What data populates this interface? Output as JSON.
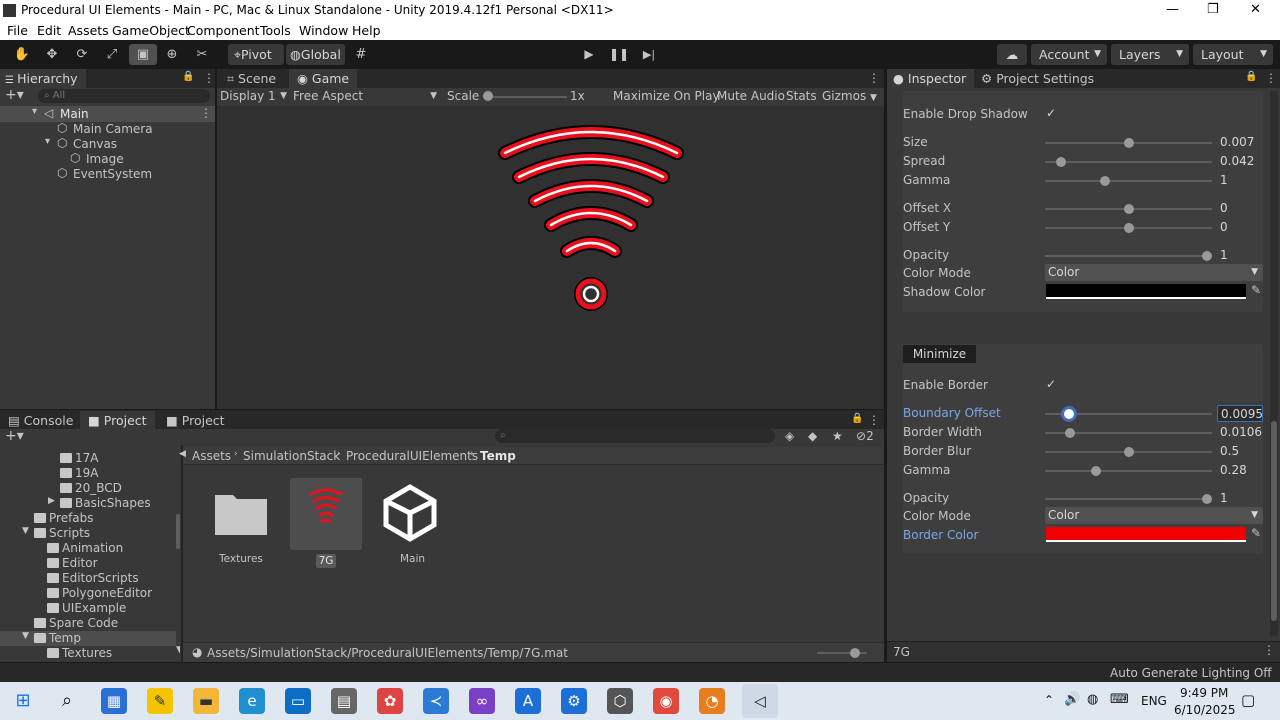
{
  "window": {
    "title": "Procedural UI Elements - Main - PC, Mac & Linux Standalone - Unity 2019.4.12f1 Personal <DX11>"
  },
  "menu": [
    "File",
    "Edit",
    "Assets",
    "GameObject",
    "Component",
    "Tools",
    "Window",
    "Help"
  ],
  "toolbar": {
    "pivot": "Pivot",
    "global": "Global",
    "account": "Account",
    "layers": "Layers",
    "layout": "Layout"
  },
  "hierarchy": {
    "tab": "Hierarchy",
    "search_placeholder": "All",
    "items": [
      {
        "label": "Main"
      },
      {
        "label": "Main Camera"
      },
      {
        "label": "Canvas"
      },
      {
        "label": "Image"
      },
      {
        "label": "EventSystem"
      }
    ]
  },
  "game": {
    "tabs": [
      "Scene",
      "Game"
    ],
    "display": "Display 1",
    "aspect": "Free Aspect",
    "scale_label": "Scale",
    "scale_value": "1x",
    "maximize": "Maximize On Play",
    "mute": "Mute Audio",
    "stats": "Stats",
    "gizmos": "Gizmos",
    "icon_color": "#e8101c"
  },
  "inspector": {
    "tabs": [
      "Inspector",
      "Project Settings"
    ],
    "shadow": {
      "enable_label": "Enable Drop Shadow",
      "fields": [
        {
          "label": "Size",
          "value": "0.007",
          "fraction": 0.5
        },
        {
          "label": "Spread",
          "value": "0.042",
          "fraction": 0.07
        },
        {
          "label": "Gamma",
          "value": "1",
          "fraction": 0.35
        },
        {
          "label": "Offset X",
          "value": "0",
          "fraction": 0.5
        },
        {
          "label": "Offset Y",
          "value": "0",
          "fraction": 0.5
        },
        {
          "label": "Opacity",
          "value": "1",
          "fraction": 1.0
        }
      ],
      "color_mode_label": "Color Mode",
      "color_mode_value": "Color",
      "shadow_color_label": "Shadow Color",
      "shadow_color": "#000000"
    },
    "minimize": {
      "header": "Minimize",
      "enable_label": "Enable Border",
      "fields": [
        {
          "label": "Boundary Offset",
          "value": "0.0095",
          "fraction": 0.12,
          "highlight": true
        },
        {
          "label": "Border Width",
          "value": "0.0106",
          "fraction": 0.13
        },
        {
          "label": "Border Blur",
          "value": "0.5",
          "fraction": 0.5
        },
        {
          "label": "Gamma",
          "value": "0.28",
          "fraction": 0.29
        },
        {
          "label": "Opacity",
          "value": "1",
          "fraction": 1.0
        }
      ],
      "color_mode_label": "Color Mode",
      "color_mode_value": "Color",
      "border_color_label": "Border Color",
      "border_color": "#f00000"
    },
    "footer_name": "7G"
  },
  "project": {
    "tabs": [
      "Console",
      "Project",
      "Project"
    ],
    "count": "2",
    "tree": [
      {
        "label": "17A",
        "depth": 3
      },
      {
        "label": "19A",
        "depth": 3
      },
      {
        "label": "20_BCD",
        "depth": 3
      },
      {
        "label": "BasicShapes",
        "depth": 3,
        "fold": true
      },
      {
        "label": "Prefabs",
        "depth": 1
      },
      {
        "label": "Scripts",
        "depth": 1,
        "open": true
      },
      {
        "label": "Animation",
        "depth": 2
      },
      {
        "label": "Editor",
        "depth": 2
      },
      {
        "label": "EditorScripts",
        "depth": 2
      },
      {
        "label": "PolygoneEditor",
        "depth": 2
      },
      {
        "label": "UIExample",
        "depth": 2
      },
      {
        "label": "Spare Code",
        "depth": 1
      },
      {
        "label": "Temp",
        "depth": 1,
        "open": true,
        "selected": true
      },
      {
        "label": "Textures",
        "depth": 2
      }
    ],
    "breadcrumb": [
      "Assets",
      "SimulationStack",
      "ProceduralUIElements",
      "Temp"
    ],
    "assets": [
      {
        "label": "Textures",
        "kind": "folder"
      },
      {
        "label": "7G",
        "kind": "material"
      },
      {
        "label": "Main",
        "kind": "scene"
      }
    ],
    "path": "Assets/SimulationStack/ProceduralUIElements/Temp/7G.mat"
  },
  "status": {
    "lighting": "Auto Generate Lighting Off"
  },
  "taskbar": {
    "time": "9:49 PM",
    "date": "6/10/2025",
    "lang": "ENG"
  }
}
